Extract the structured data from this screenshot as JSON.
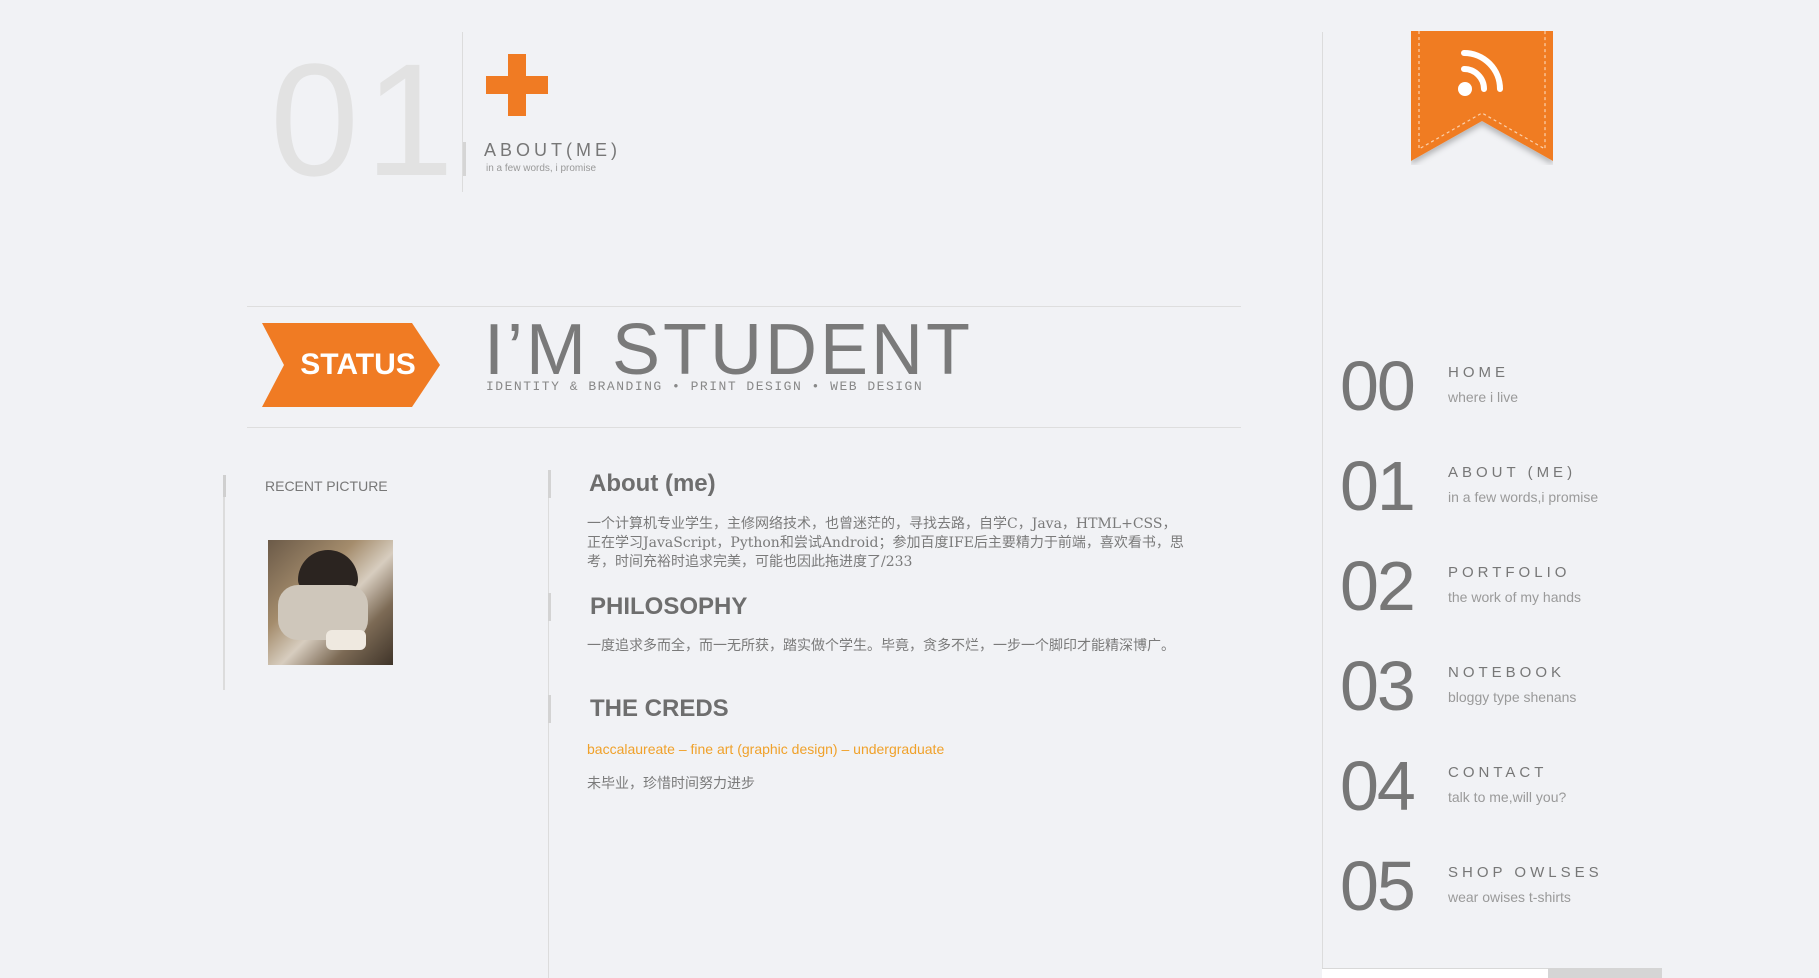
{
  "header": {
    "number": "01",
    "title": "ABOUT(ME)",
    "subtitle": "in a few words, i promise"
  },
  "status": {
    "badge_label": "STATUS",
    "headline": "I’M STUDENT",
    "tagline": "IDENTITY & BRANDING • PRINT DESIGN • WEB DESIGN"
  },
  "sidebar_left": {
    "recent_label": "RECENT PICTURE"
  },
  "main": {
    "about_heading": "About (me)",
    "about_text": "一个计算机专业学生，主修网络技术，也曾迷茫的，寻找去路，自学C，Java，HTML+CSS，正在学习JavaScript，Python和尝试Android；参加百度IFE后主要精力于前端，喜欢看书，思考，时间充裕时追求完美，可能也因此拖进度了/233",
    "philosophy_heading": "PHILOSOPHY",
    "philosophy_text": "一度追求多而全，而一无所获，踏实做个学生。毕竟，贪多不烂，一步一个脚印才能精深博广。",
    "creds_heading": "THE CREDS",
    "creds_line": "baccalaureate – fine art (graphic design) – undergraduate",
    "creds_text": "未毕业，珍惜时间努力进步"
  },
  "nav": {
    "items": [
      {
        "num": "00",
        "title": "HOME",
        "sub": "where i live"
      },
      {
        "num": "01",
        "title": "ABOUT (ME)",
        "sub": "in a few words,i promise"
      },
      {
        "num": "02",
        "title": "PORTFOLIO",
        "sub": "the work of my hands"
      },
      {
        "num": "03",
        "title": "NOTEBOOK",
        "sub": "bloggy type shenans"
      },
      {
        "num": "04",
        "title": "CONTACT",
        "sub": "talk to me,will you?"
      },
      {
        "num": "05",
        "title": "SHOP OWLSES",
        "sub": "wear owises t-shirts"
      }
    ]
  },
  "colors": {
    "accent": "#f07b23",
    "background": "#f1f2f5",
    "link": "#f0a12a"
  },
  "icons": {
    "feed": "rss-icon"
  }
}
